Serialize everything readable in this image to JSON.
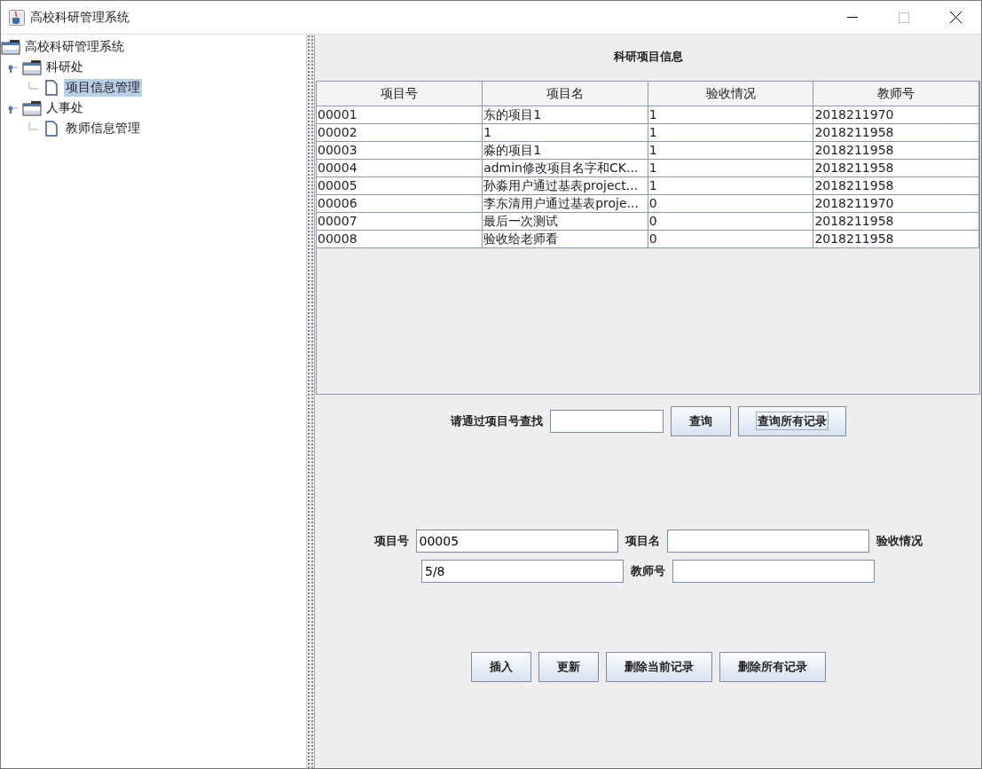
{
  "window": {
    "title": "高校科研管理系统"
  },
  "tree": {
    "label": "高校科研管理系统",
    "selected": false,
    "children": [
      {
        "label": "科研处",
        "expanded": true,
        "selected": false,
        "children": [
          {
            "label": "项目信息管理",
            "selected": true
          }
        ]
      },
      {
        "label": "人事处",
        "expanded": true,
        "selected": false,
        "children": [
          {
            "label": "教师信息管理",
            "selected": false
          }
        ]
      }
    ]
  },
  "panel_title": "科研项目信息",
  "table": {
    "columns": [
      "项目号",
      "项目名",
      "验收情况",
      "教师号"
    ],
    "rows": [
      [
        "00001",
        "东的项目1",
        "1",
        "2018211970"
      ],
      [
        "00002",
        "1",
        "1",
        "2018211958"
      ],
      [
        "00003",
        "淼的项目1",
        "1",
        "2018211958"
      ],
      [
        "00004",
        "admin修改项目名字和CK...",
        "1",
        "2018211958"
      ],
      [
        "00005",
        "孙淼用户通过基表project...",
        "1",
        "2018211958"
      ],
      [
        "00006",
        "李东清用户通过基表proje...",
        "0",
        "2018211970"
      ],
      [
        "00007",
        "最后一次测试",
        "0",
        "2018211958"
      ],
      [
        "00008",
        "验收给老师看",
        "0",
        "2018211958"
      ]
    ]
  },
  "search": {
    "label": "请通过项目号查找",
    "buttons": [
      {
        "label": "查询",
        "focused": false
      },
      {
        "label": "查询所有记录",
        "focused": true
      }
    ]
  },
  "form_rows": [
    [
      {
        "kind": "label",
        "text": "项目号"
      },
      {
        "kind": "input",
        "value": "00005"
      },
      {
        "kind": "label",
        "text": "项目名"
      },
      {
        "kind": "input"
      },
      {
        "kind": "label",
        "text": "验收情况"
      }
    ],
    [
      {
        "kind": "input",
        "value": "5/8"
      },
      {
        "kind": "label",
        "text": "教师号"
      },
      {
        "kind": "input"
      }
    ]
  ],
  "buttons": [
    "插入",
    "更新",
    "删除当前记录",
    "删除所有记录"
  ]
}
